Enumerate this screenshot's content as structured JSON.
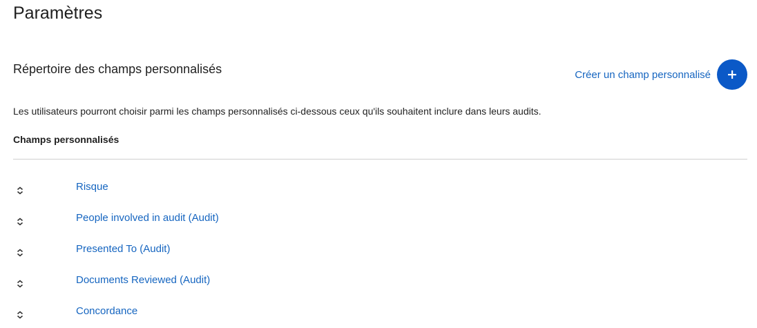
{
  "page": {
    "title": "Paramètres"
  },
  "section": {
    "title": "Répertoire des champs personnalisés",
    "create_label": "Créer un champ personnalisé",
    "create_icon": "plus-icon",
    "description": "Les utilisateurs pourront choisir parmi les champs personnalisés ci-dessous ceux qu'ils souhaitent inclure dans leurs audits.",
    "list_header": "Champs personnalisés"
  },
  "colors": {
    "accent": "#0b59c7",
    "link": "#1565c0",
    "divider": "#cfcfcf"
  },
  "fields": [
    {
      "label": "Risque",
      "icon": "sort-handle-icon"
    },
    {
      "label": "People involved in audit (Audit)",
      "icon": "sort-handle-icon"
    },
    {
      "label": "Presented To (Audit)",
      "icon": "sort-handle-icon"
    },
    {
      "label": "Documents Reviewed (Audit)",
      "icon": "sort-handle-icon"
    },
    {
      "label": "Concordance",
      "icon": "sort-handle-icon"
    }
  ]
}
